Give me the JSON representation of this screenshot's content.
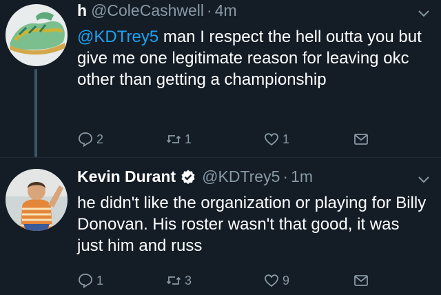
{
  "tweets": [
    {
      "display_name": "h",
      "handle": "@ColeCashwell",
      "separator": "·",
      "time": "4m",
      "mention": "@KDTrey5",
      "text": " man I respect the hell outta you but give me one legitimate reason for leaving okc other than getting a championship",
      "reply_count": "2",
      "retweet_count": "1",
      "like_count": "1",
      "verified": false
    },
    {
      "display_name": "Kevin Durant",
      "handle": "@KDTrey5",
      "separator": "·",
      "time": "1m",
      "mention": "",
      "text": "he didn't like the organization or playing for Billy Donovan. His roster wasn't that good, it was just him and russ",
      "reply_count": "1",
      "retweet_count": "3",
      "like_count": "9",
      "verified": true
    }
  ],
  "colors": {
    "background": "#141d26",
    "text": "#ffffff",
    "secondary": "#8899a6",
    "link": "#1da1f2"
  },
  "icons": [
    "shoe-avatar-icon",
    "person-avatar-icon",
    "verified-badge-icon",
    "chevron-down-icon",
    "reply-icon",
    "retweet-icon",
    "like-icon",
    "direct-message-icon"
  ]
}
